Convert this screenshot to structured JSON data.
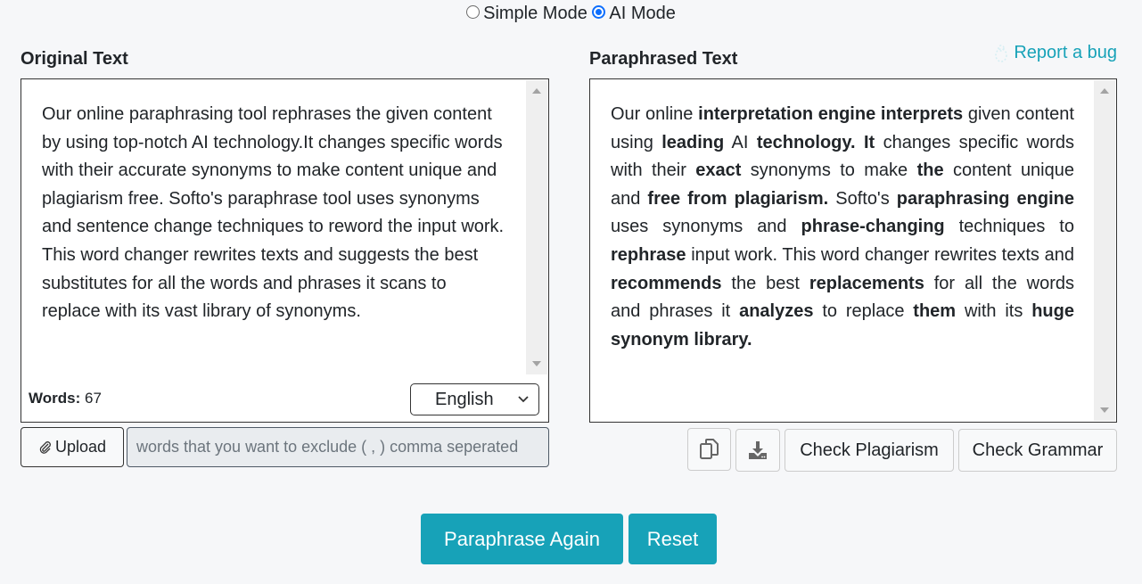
{
  "mode": {
    "options": [
      {
        "label": "Simple Mode",
        "checked": false
      },
      {
        "label": "AI Mode",
        "checked": true
      }
    ]
  },
  "original": {
    "title": "Original Text",
    "text": "Our online paraphrasing tool rephrases the given content by using top-notch AI technology.It changes specific words with their accurate synonyms to make content unique and plagiarism free. Softo's paraphrase tool uses synonyms and sentence change techniques to reword the input work. This word changer rewrites texts and suggests the best substitutes for all the words and phrases it scans to replace with its vast library of synonyms.",
    "words_label": "Words:",
    "words_count": "67",
    "language": "English",
    "upload_label": "Upload",
    "exclude_placeholder": "words that you want to exclude ( , ) comma seperated"
  },
  "paraphrased": {
    "title": "Paraphrased Text",
    "report_bug": "Report a bug",
    "segments": [
      {
        "t": "Our online ",
        "b": false
      },
      {
        "t": "interpretation engine interprets",
        "b": true
      },
      {
        "t": " given content using ",
        "b": false
      },
      {
        "t": "leading",
        "b": true
      },
      {
        "t": " AI ",
        "b": false
      },
      {
        "t": "technology. It",
        "b": true
      },
      {
        "t": " changes specific words with their ",
        "b": false
      },
      {
        "t": "exact",
        "b": true
      },
      {
        "t": " synonyms to make ",
        "b": false
      },
      {
        "t": "the",
        "b": true
      },
      {
        "t": " content unique and ",
        "b": false
      },
      {
        "t": "free from plagiarism.",
        "b": true
      },
      {
        "t": " Softo's ",
        "b": false
      },
      {
        "t": "paraphrasing engine",
        "b": true
      },
      {
        "t": " uses synonyms and ",
        "b": false
      },
      {
        "t": "phrase-changing",
        "b": true
      },
      {
        "t": " techniques to ",
        "b": false
      },
      {
        "t": "rephrase",
        "b": true
      },
      {
        "t": " input work. This word changer rewrites texts and ",
        "b": false
      },
      {
        "t": "recommends",
        "b": true
      },
      {
        "t": " the best ",
        "b": false
      },
      {
        "t": "replacements",
        "b": true
      },
      {
        "t": " for all the words and phrases it ",
        "b": false
      },
      {
        "t": "analyzes",
        "b": true
      },
      {
        "t": " to replace ",
        "b": false
      },
      {
        "t": "them",
        "b": true
      },
      {
        "t": " with its ",
        "b": false
      },
      {
        "t": "huge synonym library.",
        "b": true
      }
    ],
    "check_plagiarism": "Check Plagiarism",
    "check_grammar": "Check Grammar"
  },
  "actions": {
    "paraphrase_again": "Paraphrase Again",
    "reset": "Reset"
  },
  "colors": {
    "accent": "#17a2b8",
    "radio": "#0d6efd"
  }
}
